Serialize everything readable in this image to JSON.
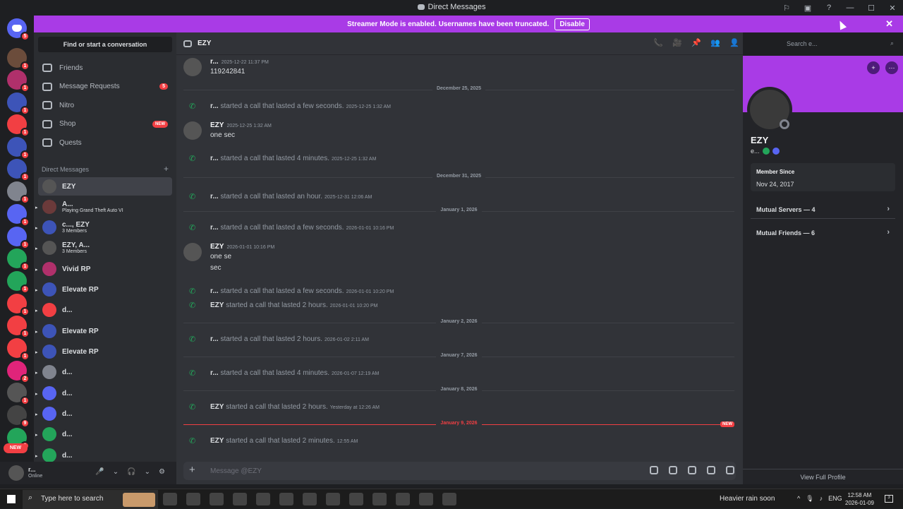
{
  "window": {
    "title": "Direct Messages",
    "controls": [
      "⚐",
      "▣",
      "?",
      "—",
      "☐",
      "✕"
    ]
  },
  "banner": {
    "text": "Streamer Mode is enabled. Usernames have been truncated.",
    "button": "Disable",
    "close": "✕"
  },
  "guilds": [
    {
      "badge": "5",
      "color": "#5865f2"
    },
    {
      "badge": "1",
      "color": "#6b4c3b"
    },
    {
      "badge": "1",
      "color": "#b0306b"
    },
    {
      "badge": "1",
      "color": "#3d54b8"
    },
    {
      "badge": "1",
      "color": "#f23f43"
    },
    {
      "badge": "1",
      "color": "#3d54b8"
    },
    {
      "badge": "1",
      "color": "#3d54b8"
    },
    {
      "badge": "1",
      "color": "#80848e"
    },
    {
      "badge": "1",
      "color": "#5865f2"
    },
    {
      "badge": "1",
      "color": "#5865f2"
    },
    {
      "badge": "1",
      "color": "#23a55a"
    },
    {
      "badge": "1",
      "color": "#23a55a"
    },
    {
      "badge": "1",
      "color": "#f23f43"
    },
    {
      "badge": "1",
      "color": "#f23f43"
    },
    {
      "badge": "1",
      "color": "#f23f43"
    },
    {
      "badge": "2",
      "color": "#e0247a"
    },
    {
      "badge": "1",
      "color": "#555555"
    },
    {
      "badge": "9",
      "color": "#444444"
    },
    {
      "badge": "1",
      "color": "#23a55a"
    }
  ],
  "guild_new": "NEW",
  "dm_sidebar": {
    "find": "Find or start a conversation",
    "nav": [
      {
        "label": "Friends"
      },
      {
        "label": "Message Requests",
        "count": "5"
      },
      {
        "label": "Nitro"
      },
      {
        "label": "Shop",
        "new": "NEW"
      },
      {
        "label": "Quests"
      }
    ],
    "header": "Direct Messages",
    "add": "+",
    "dms": [
      {
        "name": "EZY",
        "sub": "",
        "color": "#555"
      },
      {
        "name": "A...",
        "sub": "Playing Grand Theft Auto VI",
        "color": "#6b3a3a"
      },
      {
        "name": "c..., EZY",
        "sub": "3 Members",
        "color": "#3d54b8"
      },
      {
        "name": "EZY, A...",
        "sub": "3 Members",
        "color": "#555"
      },
      {
        "name": "Vivid RP",
        "sub": "",
        "color": "#b0306b"
      },
      {
        "name": "Elevate RP",
        "sub": "",
        "color": "#3d54b8"
      },
      {
        "name": "d...",
        "sub": "",
        "color": "#f23f43"
      },
      {
        "name": "Elevate RP",
        "sub": "",
        "color": "#3d54b8"
      },
      {
        "name": "Elevate RP",
        "sub": "",
        "color": "#3d54b8"
      },
      {
        "name": "d...",
        "sub": "",
        "color": "#80848e"
      },
      {
        "name": "d...",
        "sub": "",
        "color": "#5865f2"
      },
      {
        "name": "d...",
        "sub": "",
        "color": "#5865f2"
      },
      {
        "name": "d...",
        "sub": "",
        "color": "#23a55a"
      },
      {
        "name": "d...",
        "sub": "",
        "color": "#23a55a"
      }
    ]
  },
  "user": {
    "name": "r...",
    "status": "Online",
    "controls": [
      "🎤",
      "⌄",
      "🎧",
      "⌄",
      "⚙"
    ]
  },
  "chat": {
    "title": "EZY",
    "header_icons": [
      "📞",
      "🎥",
      "📌",
      "👥",
      "👤"
    ],
    "search_placeholder": "Search e...",
    "composer_placeholder": "Message @EZY",
    "msgs": [
      {
        "author": "r...",
        "ts": "2025-12-22 11:37 PM",
        "lines": [
          "119242841"
        ]
      },
      {
        "divider": "December 25, 2025"
      },
      {
        "call": "r...",
        "text": "started a call that lasted a few seconds.",
        "ts": "2025-12-25 1:32 AM"
      },
      {
        "author": "EZY",
        "ts": "2025-12-25 1:32 AM",
        "lines": [
          "one sec"
        ]
      },
      {
        "call": "r...",
        "text": "started a call that lasted 4 minutes.",
        "ts": "2025-12-25 1:32 AM"
      },
      {
        "divider": "December 31, 2025"
      },
      {
        "call": "r...",
        "text": "started a call that lasted an hour.",
        "ts": "2025-12-31 12:06 AM"
      },
      {
        "divider": "January 1, 2026"
      },
      {
        "call": "r...",
        "text": "started a call that lasted a few seconds.",
        "ts": "2026-01-01 10:16 PM"
      },
      {
        "author": "EZY",
        "ts": "2026-01-01 10:16 PM",
        "lines": [
          "one se",
          "sec"
        ]
      },
      {
        "call": "r...",
        "text": "started a call that lasted a few seconds.",
        "ts": "2026-01-01 10:20 PM"
      },
      {
        "call": "EZY",
        "text": "started a call that lasted 2 hours.",
        "ts": "2026-01-01 10:20 PM"
      },
      {
        "divider": "January 2, 2026"
      },
      {
        "call": "r...",
        "text": "started a call that lasted 2 hours.",
        "ts": "2026-01-02 2:11 AM"
      },
      {
        "divider": "January 7, 2026"
      },
      {
        "call": "r...",
        "text": "started a call that lasted 4 minutes.",
        "ts": "2026-01-07 12:19 AM"
      },
      {
        "divider": "January 8, 2026"
      },
      {
        "call": "EZY",
        "text": "started a call that lasted 2 hours.",
        "ts": "Yesterday at 12:26 AM"
      },
      {
        "divider": "January 9, 2026",
        "red": true,
        "new": "NEW"
      },
      {
        "call": "EZY",
        "text": "started a call that lasted 2 minutes.",
        "ts": "12:55 AM"
      }
    ]
  },
  "profile": {
    "name": "EZY",
    "tag": "e...",
    "member_since_label": "Member Since",
    "member_since": "Nov 24, 2017",
    "mutual_servers": "Mutual Servers — 4",
    "mutual_friends": "Mutual Friends — 6",
    "view_full": "View Full Profile",
    "banner_color": "#a93be6"
  },
  "taskbar": {
    "search": "Type here to search",
    "weather": "Heavier rain soon",
    "lang": "ENG",
    "time": "12:58 AM",
    "date": "2026-01-09",
    "notif": "3"
  }
}
